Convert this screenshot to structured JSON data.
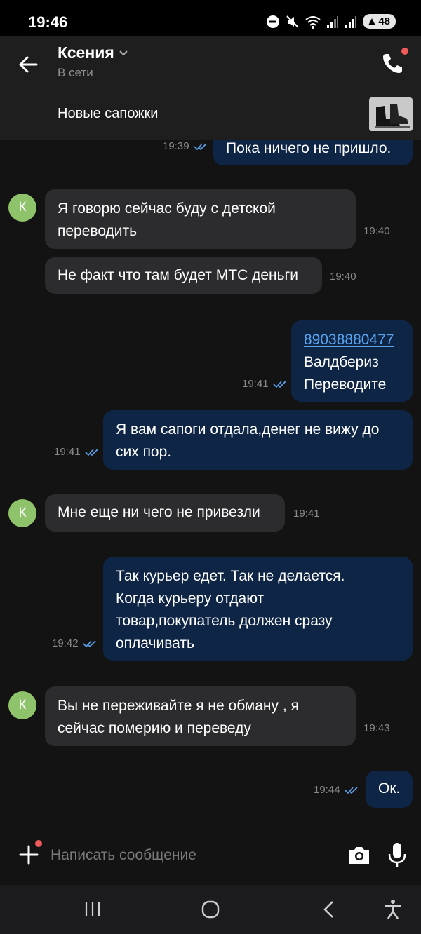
{
  "status_bar": {
    "time": "19:46",
    "battery": "48"
  },
  "header": {
    "contact_name": "Ксения",
    "contact_status": "В сети"
  },
  "product": {
    "title": "Новые сапожки"
  },
  "messages": [
    {
      "dir": "out",
      "text": "Пока ничего не пришло.",
      "time": "19:39",
      "read": true
    },
    {
      "dir": "in",
      "avatar": "К",
      "text_lines": [
        "Я говорю сейчас буду с детской",
        "переводить"
      ],
      "time": "19:40"
    },
    {
      "dir": "in",
      "text": "Не факт что там будет МТС деньги",
      "time": "19:40"
    },
    {
      "dir": "out",
      "link": "89038880477",
      "text_lines": [
        "Валдбериз",
        "Переводите"
      ],
      "time": "19:41",
      "read": true
    },
    {
      "dir": "out",
      "text_lines": [
        "Я вам сапоги отдала,денег не вижу до",
        "сих пор."
      ],
      "time": "19:41",
      "read": true
    },
    {
      "dir": "in",
      "avatar": "К",
      "text": "Мне еще ни чего не привезли",
      "time": "19:41"
    },
    {
      "dir": "out",
      "text_lines": [
        "Так курьер едет. Так не делается.",
        "Когда курьеру отдают",
        "товар,покупатель должен сразу",
        "оплачивать"
      ],
      "time": "19:42",
      "read": true
    },
    {
      "dir": "in",
      "avatar": "К",
      "text_lines": [
        "Вы не переживайте я не обману , я",
        "сейчас померию и переведу"
      ],
      "time": "19:43"
    },
    {
      "dir": "out",
      "text": "Ок.",
      "time": "19:44",
      "read": true
    }
  ],
  "composer": {
    "placeholder": "Написать сообщение"
  },
  "colors": {
    "accent": "#5aa4f0",
    "bubble_out": "#0e2546",
    "bubble_in": "#2c2c2e",
    "avatar": "#8fc36b",
    "badge": "#f05a5a"
  }
}
